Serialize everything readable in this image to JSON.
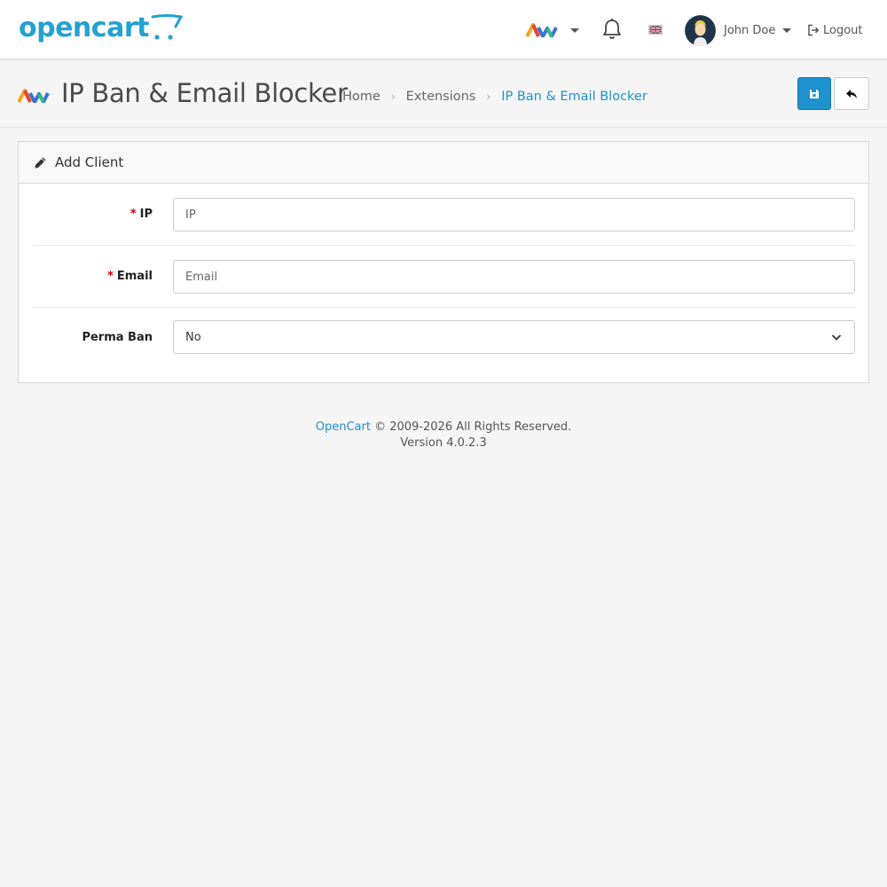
{
  "header": {
    "logo_text": "opencart",
    "user_name": "John Doe",
    "logout_label": "Logout",
    "icons": {
      "aw": "aw-logo-icon",
      "notifications": "bell-icon",
      "language": "uk-flag-icon",
      "logout": "sign-out-icon"
    }
  },
  "page": {
    "title": "IP Ban & Email Blocker",
    "breadcrumb": [
      "Home",
      "Extensions",
      "IP Ban & Email Blocker"
    ],
    "buttons": {
      "save": "floppy-disk-icon",
      "back": "reply-icon"
    }
  },
  "card": {
    "title": "Add Client",
    "icon": "pencil-icon",
    "fields": {
      "ip": {
        "label": "IP",
        "required_mark": "*",
        "value": "",
        "placeholder": "IP"
      },
      "email": {
        "label": "Email",
        "required_mark": "*",
        "value": "",
        "placeholder": "Email"
      },
      "perma_ban": {
        "label": "Perma Ban",
        "value": "No"
      }
    }
  },
  "footer": {
    "link": "OpenCart",
    "copyright": "© 2009-2026 All Rights Reserved.",
    "version": "Version 4.0.2.3"
  },
  "colors": {
    "primary": "#1e91cf",
    "logo": "#23a1d1",
    "required": "#cc0000",
    "background": "#f5f5f5"
  }
}
